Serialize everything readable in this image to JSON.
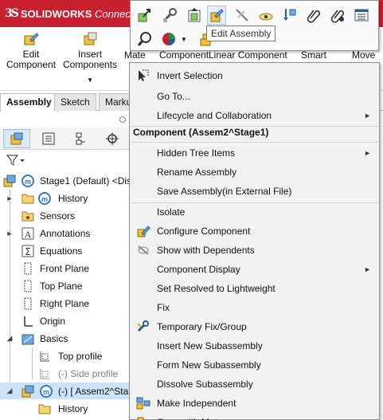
{
  "app": {
    "brand_logo": "3S",
    "brand_name": "SOLIDWORKS",
    "brand_suffix": "Connec"
  },
  "command_manager": {
    "edit_component": [
      "Edit",
      "Component"
    ],
    "insert_components": [
      "Insert",
      "Components"
    ],
    "clipped": [
      "Mate",
      "Component",
      "Linear Component",
      "Smart",
      "Move"
    ]
  },
  "tabs": [
    "Assembly",
    "Sketch",
    "Marku"
  ],
  "tree": [
    {
      "label": "Stage1 (Default) <Dis",
      "icon": "assembly-icon"
    },
    {
      "label": "History",
      "icon": "history-icon"
    },
    {
      "label": "Sensors",
      "icon": "sensors-icon"
    },
    {
      "label": "Annotations",
      "icon": "annotations-icon"
    },
    {
      "label": "Equations",
      "icon": "equations-icon"
    },
    {
      "label": "Front Plane",
      "icon": "plane-icon"
    },
    {
      "label": "Top Plane",
      "icon": "plane-icon"
    },
    {
      "label": "Right Plane",
      "icon": "plane-icon"
    },
    {
      "label": "Origin",
      "icon": "origin-icon"
    },
    {
      "label": "Basics",
      "icon": "folder-icon"
    },
    {
      "label": "Top profile",
      "icon": "sketch-icon"
    },
    {
      "label": "(-) Side profile",
      "icon": "sketch-icon"
    },
    {
      "label": "(-) [ Assem2^Sta",
      "icon": "subassembly-icon"
    },
    {
      "label": "History",
      "icon": "history-icon"
    }
  ],
  "context_toolbar": {
    "tooltip": "Edit Assembly"
  },
  "context_menu": {
    "header": "Component (Assem2^Stage1)",
    "items": [
      "Invert Selection",
      "Go To...",
      "Lifecycle and Collaboration",
      "Hidden Tree Items",
      "Rename Assembly",
      "Save Assembly(in External File)",
      "Isolate",
      "Configure Component",
      "Show with Dependents",
      "Component Display",
      "Set Resolved to Lightweight",
      "Fix",
      "Temporary Fix/Group",
      "Insert New Subassembly",
      "Form New Subassembly",
      "Dissolve Subassembly",
      "Make Independent",
      "Copy with Mates"
    ]
  },
  "colors": {
    "brand_red": "#c8202e",
    "menu_bg": "#f2f2f2",
    "selection": "#cde4f8"
  }
}
